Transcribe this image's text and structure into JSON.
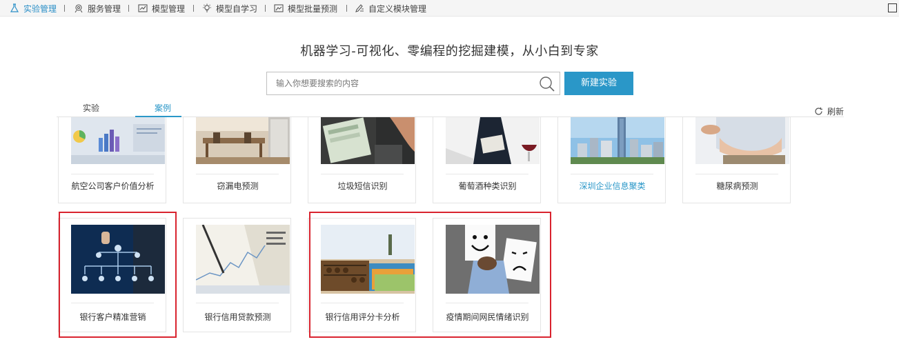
{
  "nav": {
    "items": [
      {
        "label": "实验管理",
        "icon": "flask-icon",
        "active": true
      },
      {
        "label": "服务管理",
        "icon": "service-gear-icon",
        "active": false
      },
      {
        "label": "模型管理",
        "icon": "model-chart-icon",
        "active": false
      },
      {
        "label": "模型自学习",
        "icon": "lightbulb-icon",
        "active": false
      },
      {
        "label": "模型批量预测",
        "icon": "batch-predict-icon",
        "active": false
      },
      {
        "label": "自定义模块管理",
        "icon": "pencil-list-icon",
        "active": false
      }
    ]
  },
  "headline": "机器学习-可视化、零编程的挖掘建模，从小白到专家",
  "search": {
    "placeholder": "输入你想要搜索的内容",
    "value": ""
  },
  "new_button": "新建实验",
  "tabs": [
    {
      "label": "实验",
      "active": false
    },
    {
      "label": "案例",
      "active": true
    }
  ],
  "refresh_label": "刷新",
  "cases_row1": [
    {
      "title": "航空公司客户价值分析",
      "image": "business-charts-photo"
    },
    {
      "title": "窃漏电预测",
      "image": "dining-room-photo"
    },
    {
      "title": "垃圾短信识别",
      "image": "phone-sms-photo"
    },
    {
      "title": "葡萄酒种类识别",
      "image": "wine-bottle-photo"
    },
    {
      "title": "深圳企业信息聚类",
      "image": "city-skyline-photo",
      "highlighted_link": true
    },
    {
      "title": "糖尿病预测",
      "image": "belly-photo"
    }
  ],
  "cases_row2": [
    {
      "title": "银行客户精准营销",
      "image": "org-chart-photo",
      "outlined": true
    },
    {
      "title": "银行信用贷款预测",
      "image": "financial-newspaper-photo",
      "outlined": false
    },
    {
      "title": "银行信用评分卡分析",
      "image": "abacus-cards-photo",
      "outlined": true
    },
    {
      "title": "疫情期间网民情绪识别",
      "image": "smiley-sad-faces-photo",
      "outlined": true
    }
  ],
  "colors": {
    "accent": "#2a97c8",
    "outline": "#d9232e",
    "nav_active": "#2a8fc7"
  }
}
